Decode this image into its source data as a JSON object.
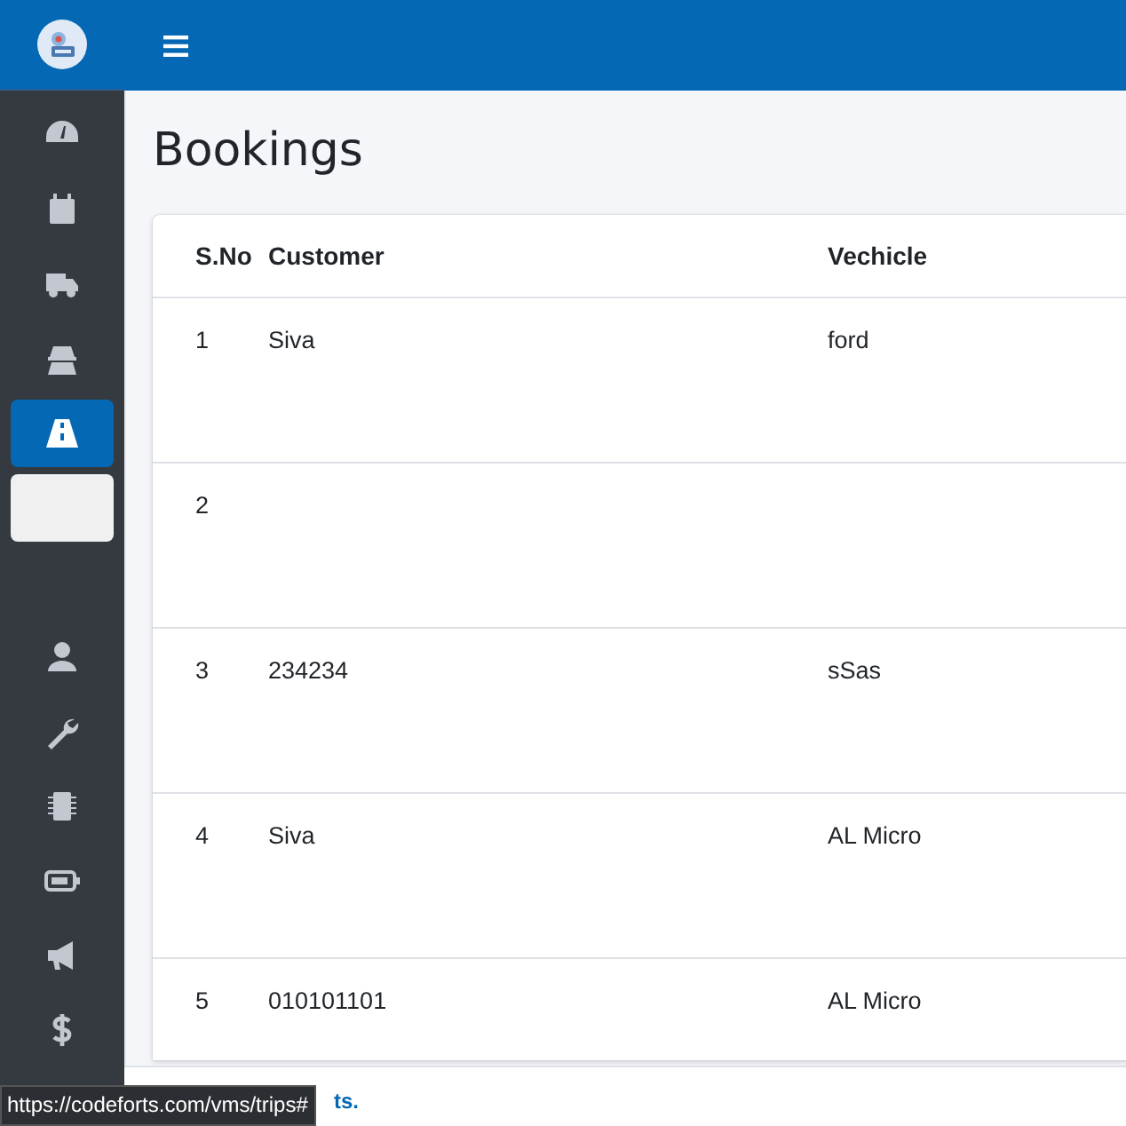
{
  "page_title": "Bookings",
  "sidebar": {
    "top_items": [
      {
        "kind": "icon",
        "selected": false
      },
      {
        "kind": "icon",
        "selected": false
      },
      {
        "kind": "icon",
        "selected": false
      },
      {
        "kind": "icon",
        "selected": false
      },
      {
        "kind": "icon",
        "selected": true
      },
      {
        "kind": "blank",
        "hovered": true
      }
    ],
    "bottom_items": [
      {
        "kind": "icon",
        "selected": false
      },
      {
        "kind": "icon",
        "selected": false
      },
      {
        "kind": "icon",
        "selected": false
      },
      {
        "kind": "icon",
        "selected": false
      },
      {
        "kind": "icon",
        "selected": false
      },
      {
        "kind": "icon",
        "selected": false
      }
    ]
  },
  "table": {
    "columns": [
      "S.No",
      "Customer",
      "Vechicle"
    ],
    "rows": [
      [
        "1",
        "Siva",
        "ford"
      ],
      [
        "2",
        "",
        ""
      ],
      [
        "3",
        "234234",
        "sSas"
      ],
      [
        "4",
        "Siva",
        "AL Micro"
      ],
      [
        "5",
        "010101101",
        "AL Micro"
      ]
    ]
  },
  "footer": {
    "text": "ts."
  },
  "status_url": "https://codeforts.com/vms/trips#"
}
